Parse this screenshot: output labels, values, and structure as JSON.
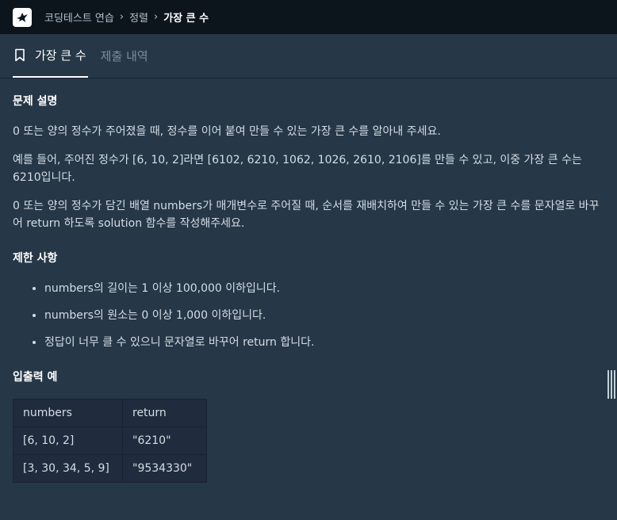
{
  "breadcrumb": {
    "items": [
      "코딩테스트 연습",
      "정렬"
    ],
    "current": "가장 큰 수"
  },
  "tabs": {
    "problem": "가장 큰 수",
    "submissions": "제출 내역"
  },
  "problem": {
    "heading": "문제 설명",
    "paragraphs": [
      "0 또는 양의 정수가 주어졌을 때, 정수를 이어 붙여 만들 수 있는 가장 큰 수를 알아내 주세요.",
      "예를 들어, 주어진 정수가 [6, 10, 2]라면 [6102, 6210, 1062, 1026, 2610, 2106]를 만들 수 있고, 이중 가장 큰 수는 6210입니다.",
      "0 또는 양의 정수가 담긴 배열 numbers가 매개변수로 주어질 때, 순서를 재배치하여 만들 수 있는 가장 큰 수를 문자열로 바꾸어 return 하도록 solution 함수를 작성해주세요."
    ]
  },
  "constraints": {
    "heading": "제한 사항",
    "items": [
      "numbers의 길이는 1 이상 100,000 이하입니다.",
      "numbers의 원소는 0 이상 1,000 이하입니다.",
      "정답이 너무 클 수 있으니 문자열로 바꾸어 return 합니다."
    ]
  },
  "examples": {
    "heading": "입출력 예",
    "headers": [
      "numbers",
      "return"
    ],
    "rows": [
      [
        "[6, 10, 2]",
        "\"6210\""
      ],
      [
        "[3, 30, 34, 5, 9]",
        "\"9534330\""
      ]
    ]
  },
  "icons": {
    "logo": "programmers-bird-logo",
    "bookmark": "bookmark-icon",
    "separator": "chevron-right-icon",
    "handle": "resize-handle"
  },
  "colors": {
    "topbar_bg": "#0c151c",
    "panel_bg": "#263747",
    "table_bg": "#202b3d",
    "text": "#d5dde5",
    "muted": "#78909c"
  }
}
